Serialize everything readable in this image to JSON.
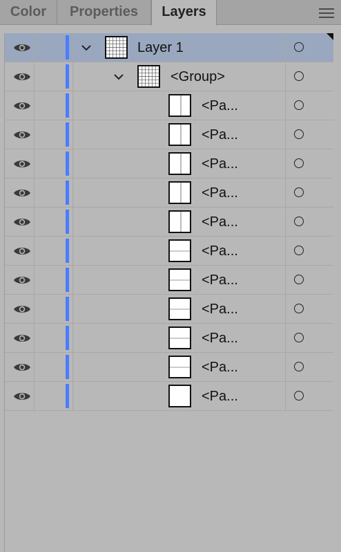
{
  "tabs": [
    {
      "label": "Color",
      "active": false
    },
    {
      "label": "Properties",
      "active": false
    },
    {
      "label": "Layers",
      "active": true
    }
  ],
  "menu_icon": "hamburger-menu-icon",
  "accent_color": "#4a7cff",
  "selection_color": "#99a8bf",
  "layers": [
    {
      "name": "Layer 1",
      "level": 0,
      "expanded": true,
      "selected": true,
      "thumb": "grid",
      "visible": true
    },
    {
      "name": "<Group>",
      "level": 1,
      "expanded": true,
      "selected": false,
      "thumb": "grid",
      "visible": true
    },
    {
      "name": "<Pa...",
      "level": 2,
      "selected": false,
      "thumb": "vline",
      "visible": true
    },
    {
      "name": "<Pa...",
      "level": 2,
      "selected": false,
      "thumb": "vline",
      "visible": true
    },
    {
      "name": "<Pa...",
      "level": 2,
      "selected": false,
      "thumb": "vline",
      "visible": true
    },
    {
      "name": "<Pa...",
      "level": 2,
      "selected": false,
      "thumb": "vline",
      "visible": true
    },
    {
      "name": "<Pa...",
      "level": 2,
      "selected": false,
      "thumb": "vline",
      "visible": true
    },
    {
      "name": "<Pa...",
      "level": 2,
      "selected": false,
      "thumb": "hline",
      "visible": true
    },
    {
      "name": "<Pa...",
      "level": 2,
      "selected": false,
      "thumb": "hline",
      "visible": true
    },
    {
      "name": "<Pa...",
      "level": 2,
      "selected": false,
      "thumb": "hline",
      "visible": true
    },
    {
      "name": "<Pa...",
      "level": 2,
      "selected": false,
      "thumb": "hline",
      "visible": true
    },
    {
      "name": "<Pa...",
      "level": 2,
      "selected": false,
      "thumb": "hline",
      "visible": true
    },
    {
      "name": "<Pa...",
      "level": 2,
      "selected": false,
      "thumb": "blank",
      "visible": true
    }
  ]
}
